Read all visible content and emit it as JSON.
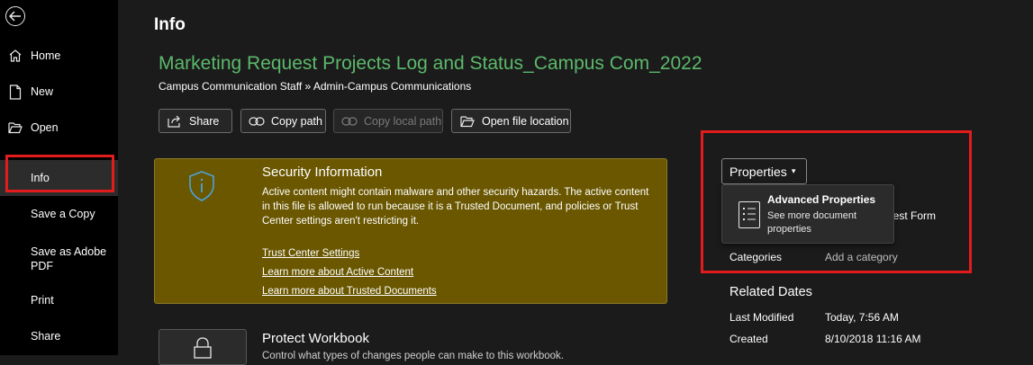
{
  "sidebar": {
    "items": [
      {
        "label": "Home",
        "icon": "home-icon"
      },
      {
        "label": "New",
        "icon": "new-document-icon"
      },
      {
        "label": "Open",
        "icon": "folder-open-icon"
      },
      {
        "label": "Info",
        "icon": ""
      },
      {
        "label": "Save a Copy",
        "icon": ""
      },
      {
        "label": "Save as Adobe PDF",
        "icon": ""
      },
      {
        "label": "Print",
        "icon": ""
      },
      {
        "label": "Share",
        "icon": ""
      }
    ],
    "active": "Info"
  },
  "page": {
    "title": "Info",
    "doc_title": "Marketing Request Projects Log and Status_Campus Com_2022",
    "breadcrumb": "Campus Communication Staff » Admin-Campus Communications"
  },
  "toolbar": {
    "share": "Share",
    "copy_path": "Copy path",
    "copy_local_path": "Copy local path",
    "open_file_location": "Open file location"
  },
  "security": {
    "title": "Security Information",
    "text": "Active content might contain malware and other security hazards. The active content in this file is allowed to run because it is a Trusted Document, and policies or Trust Center settings aren't restricting it.",
    "links": [
      "Trust Center Settings",
      "Learn more about Active Content",
      "Learn more about Trusted Documents"
    ]
  },
  "protect": {
    "title": "Protect Workbook",
    "subtitle": "Control what types of changes people can make to this workbook."
  },
  "properties": {
    "button_label": "Properties",
    "menu": {
      "title": "Advanced Properties",
      "description": "See more document properties"
    },
    "partial_title": "uest Form",
    "categories_label": "Categories",
    "categories_value": "Add a category"
  },
  "related_dates": {
    "title": "Related Dates",
    "last_modified_label": "Last Modified",
    "last_modified_value": "Today, 7:56 AM",
    "created_label": "Created",
    "created_value": "8/10/2018 11:16 AM"
  },
  "colors": {
    "accent_green": "#5cb96b",
    "highlight_red": "#e21c1c",
    "security_bg": "#6a5700"
  }
}
